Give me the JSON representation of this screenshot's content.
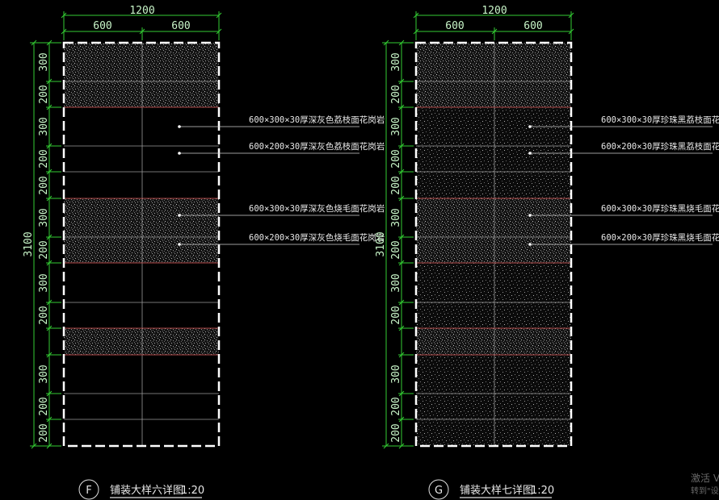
{
  "drawings": [
    {
      "id": "F",
      "title": "铺装大样六详图",
      "scale": "1:20",
      "total_width": "1200",
      "half_widths": [
        "600",
        "600"
      ],
      "total_length": "3100",
      "rows": [
        "300",
        "200",
        "300",
        "200",
        "200",
        "300",
        "200",
        "300",
        "200",
        "300",
        "200",
        "200"
      ],
      "notes": [
        "600×300×30厚深灰色荔枝面花岗岩",
        "600×200×30厚深灰色荔枝面花岗岩",
        "600×300×30厚深灰色烧毛面花岗岩",
        "600×200×30厚深灰色烧毛面花岗岩"
      ]
    },
    {
      "id": "G",
      "title": "铺装大样七详图",
      "scale": "1:20",
      "total_width": "1200",
      "half_widths": [
        "600",
        "600"
      ],
      "total_length": "3100",
      "rows": [
        "300",
        "200",
        "300",
        "200",
        "200",
        "300",
        "200",
        "300",
        "200",
        "300",
        "200",
        "200"
      ],
      "notes": [
        "600×300×30厚珍珠黑荔枝面花岗岩",
        "600×200×30厚珍珠黑荔枝面花岗岩",
        "600×300×30厚珍珠黑烧毛面花岗岩",
        "600×200×30厚珍珠黑烧毛面花岗岩"
      ]
    }
  ],
  "watermark": [
    "激活 V",
    "转到\"设"
  ],
  "colors": {
    "dimension": "#33cc33",
    "boundary": "#ffffff",
    "band_line": "#b04848",
    "joint": "#9a9a9a"
  }
}
